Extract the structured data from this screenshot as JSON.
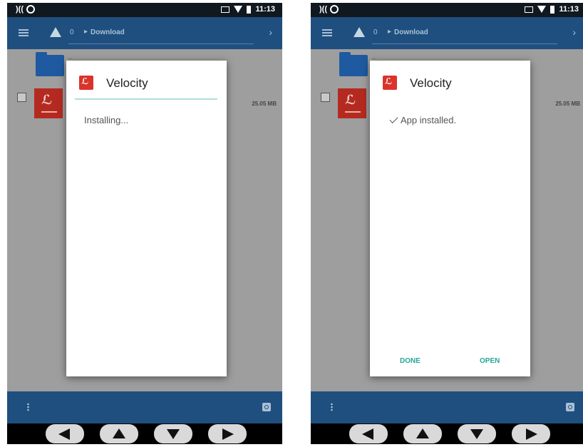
{
  "status_bar": {
    "time": "11:13",
    "left_indicator": "¦¦¦",
    "icons": [
      "nfc-icon",
      "sync-icon",
      "cast-icon",
      "wifi-icon",
      "battery-icon"
    ]
  },
  "toolbar": {
    "path_index": "0",
    "breadcrumb_folder": "Download"
  },
  "file_list": {
    "parent_dir": "..",
    "file_size": "25.05 MB"
  },
  "colors": {
    "toolbar": "#1f4f7e",
    "accent": "#26a69a",
    "app_icon": "#d9342b"
  },
  "left_dialog": {
    "title": "Velocity",
    "status": "Installing..."
  },
  "right_dialog": {
    "title": "Velocity",
    "status": "App installed.",
    "done_label": "DONE",
    "open_label": "OPEN"
  },
  "nav_keys": [
    "left-arrow-key",
    "up-arrow-key",
    "down-arrow-key",
    "right-arrow-key"
  ]
}
